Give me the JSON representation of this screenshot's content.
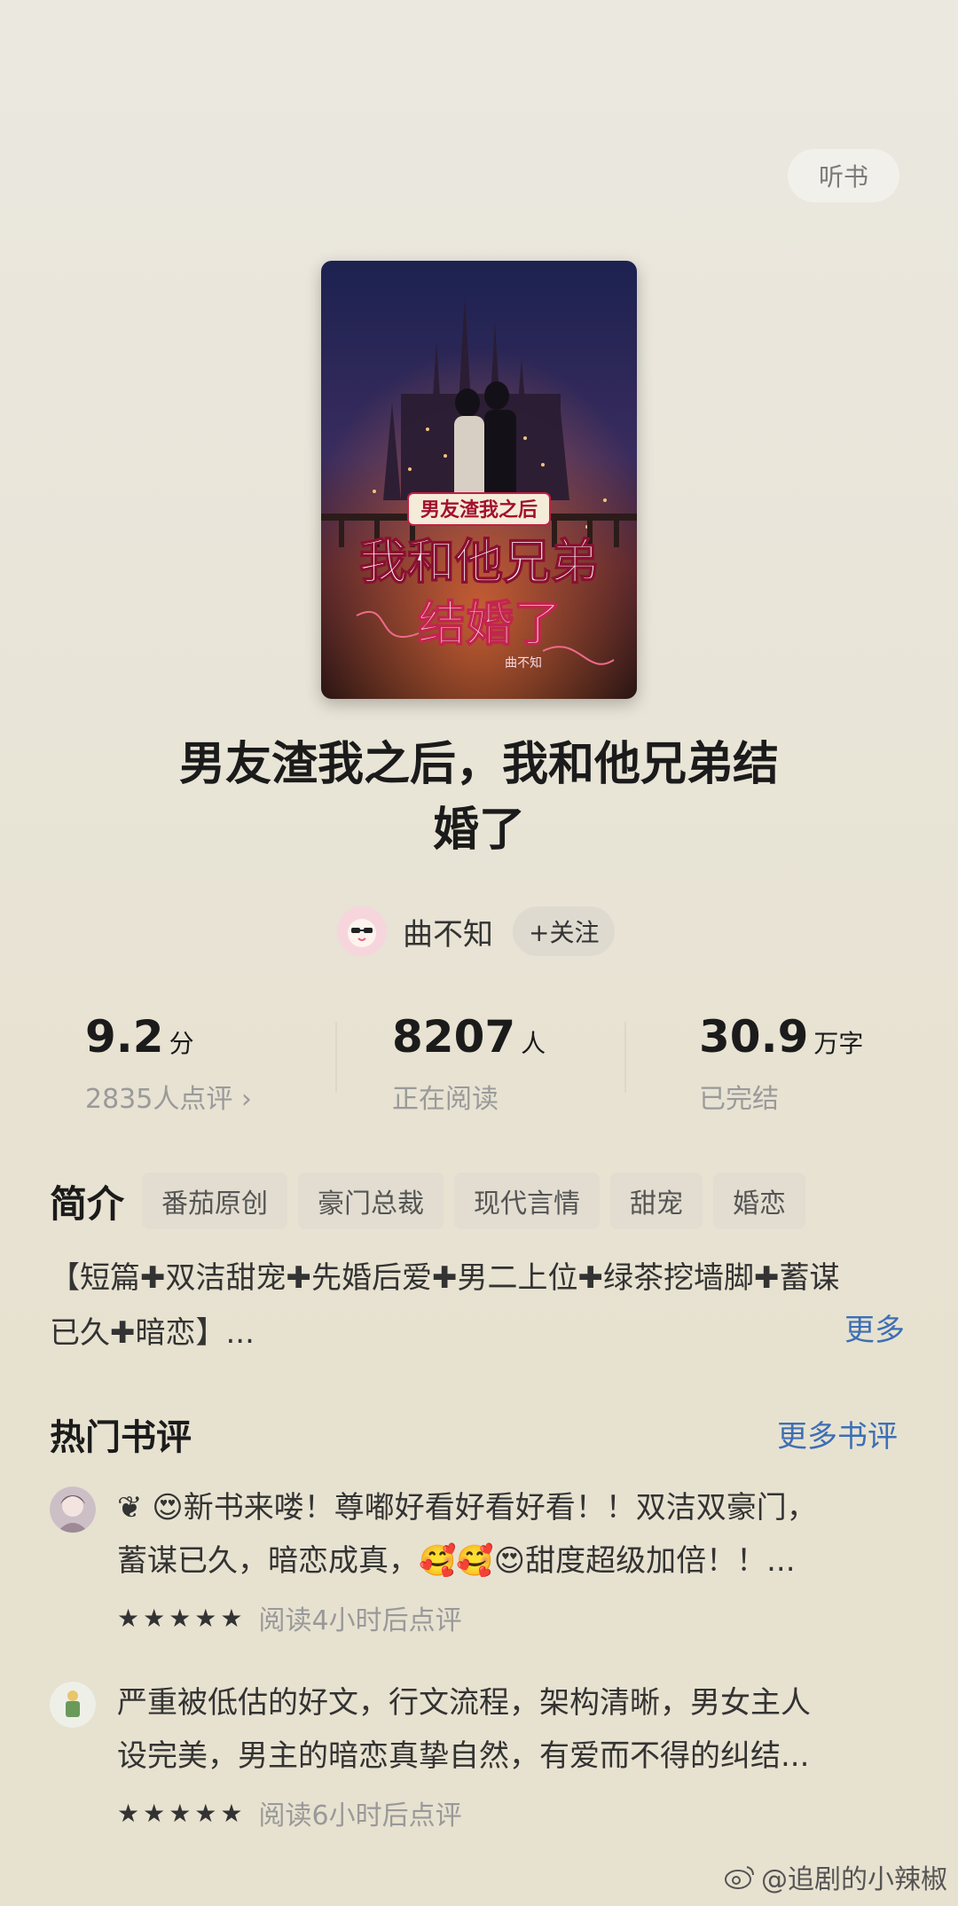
{
  "header": {
    "listen_label": "听书"
  },
  "cover": {
    "title_top": "男友渣我之后",
    "title_main": "我和他兄弟",
    "title_bottom": "结婚了",
    "author_sig": "曲不知"
  },
  "book": {
    "title_line1": "男友渣我之后，我和他兄弟结",
    "title_line2": "婚了"
  },
  "author": {
    "name": "曲不知",
    "follow_label": "+关注",
    "avatar_icon": "avatar-sunglasses-icon"
  },
  "stats": {
    "score": {
      "value": "9.2",
      "unit": "分",
      "sub": "2835人点评 ›"
    },
    "readers": {
      "value": "8207",
      "unit": "人",
      "sub": "正在阅读"
    },
    "words": {
      "value": "30.9",
      "unit": "万字",
      "sub": "已完结"
    }
  },
  "intro": {
    "label": "简介",
    "tags": [
      "番茄原创",
      "豪门总裁",
      "现代言情",
      "甜宠",
      "婚恋"
    ],
    "text_line1": "【短篇✚双洁甜宠✚先婚后爱✚男二上位✚绿茶挖墙脚✚蓄谋",
    "text_line2": "已久✚暗恋】...",
    "more_label": "更多"
  },
  "reviews": {
    "title": "热门书评",
    "more_label": "更多书评",
    "items": [
      {
        "line1": "❦ 😍新书来喽！尊嘟好看好看好看！！双洁双豪门，",
        "line2": "蓄谋已久，暗恋成真，🥰🥰😍甜度超级加倍！！...",
        "stars": "★★★★★",
        "meta": "阅读4小时后点评"
      },
      {
        "line1": "严重被低估的好文，行文流程，架构清晰，男女主人",
        "line2": "设完美，男主的暗恋真挚自然，有爱而不得的纠结...",
        "stars": "★★★★★",
        "meta": "阅读6小时后点评"
      }
    ]
  },
  "watermark": {
    "text": "@追剧的小辣椒"
  },
  "colors": {
    "accent_link": "#3d6fb6",
    "background": "#e8e4d6"
  }
}
